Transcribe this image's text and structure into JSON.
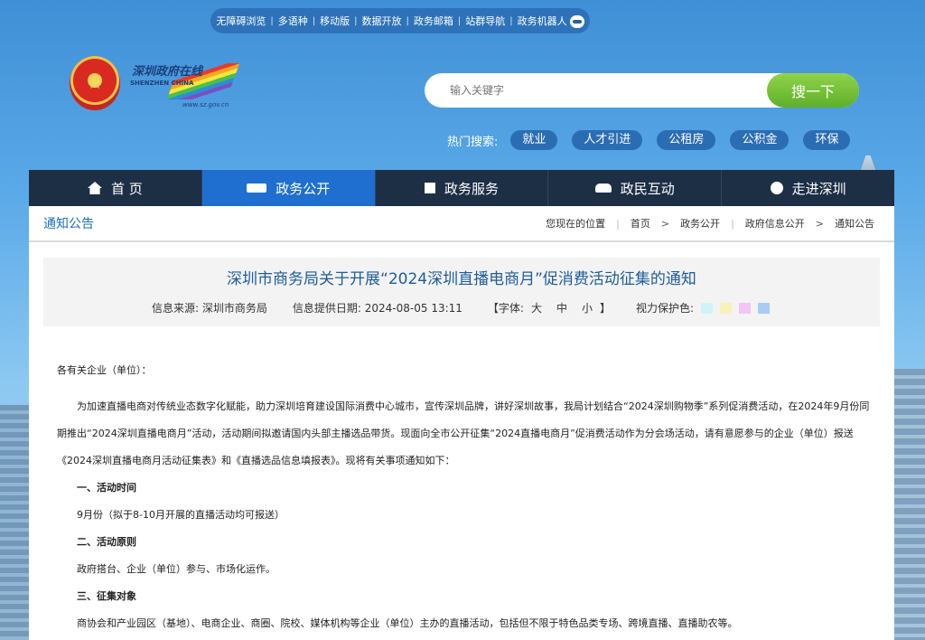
{
  "topbar": {
    "links": [
      "无障碍浏览",
      "多语种",
      "移动版",
      "数据开放",
      "政务邮箱",
      "站群导航",
      "政务机器人"
    ]
  },
  "logo": {
    "cn": "深圳政府在线",
    "en": "SHENZHEN CHINA",
    "url": "www.sz.gov.cn"
  },
  "search": {
    "placeholder": "输入关键字",
    "button": "搜一下"
  },
  "hot": {
    "label": "热门搜索:",
    "tags": [
      "就业",
      "人才引进",
      "公租房",
      "公积金",
      "环保"
    ]
  },
  "nav": {
    "items": [
      {
        "label": "首 页",
        "icon": "home-icon"
      },
      {
        "label": "政务公开",
        "icon": "news-icon"
      },
      {
        "label": "政务服务",
        "icon": "service-icon"
      },
      {
        "label": "政民互动",
        "icon": "people-icon"
      },
      {
        "label": "走进深圳",
        "icon": "chat-icon"
      }
    ],
    "active_index": 1
  },
  "breadcrumb": {
    "section": "通知公告",
    "location_label": "您现在的位置",
    "trail": [
      "首页",
      "政务公开",
      "政府信息公开",
      "通知公告"
    ]
  },
  "article": {
    "title": "深圳市商务局关于开展“2024深圳直播电商月”促消费活动征集的通知",
    "source_label": "信息来源:",
    "source": "深圳市商务局",
    "date_label": "信息提供日期:",
    "date": "2024-08-05 13:11",
    "font_label": "【字体:",
    "font_sizes": [
      "大",
      "中",
      "小"
    ],
    "font_close": "】",
    "eye_label": "视力保护色:",
    "eye_colors": [
      "#cff3f6",
      "#f7f3b8",
      "#f2c6f2",
      "#a8cdf4"
    ],
    "greeting": "各有关企业（单位）：",
    "intro": "为加速直播电商对传统业态数字化赋能，助力深圳培育建设国际消费中心城市，宣传深圳品牌，讲好深圳故事，我局计划结合“2024深圳购物季”系列促消费活动，在2024年9月份同期推出“2024深圳直播电商月”活动，活动期间拟邀请国内头部主播选品带货。现面向全市公开征集“2024直播电商月”促消费活动作为分会场活动，请有意愿参与的企业（单位）报送《2024深圳直播电商月活动征集表》和《直播选品信息填报表》。现将有关事项通知如下：",
    "s1_head": "一、活动时间",
    "s1_text": "9月份（拟于8-10月开展的直播活动均可报送）",
    "s2_head": "二、活动原则",
    "s2_text": "政府搭台、企业（单位）参与、市场化运作。",
    "s3_head": "三、征集对象",
    "s3_text": "商协会和产业园区（基地）、电商企业、商圈、院校、媒体机构等企业（单位）主办的直播活动，包括但不限于特色品类专场、跨境直播、直播助农等。"
  }
}
